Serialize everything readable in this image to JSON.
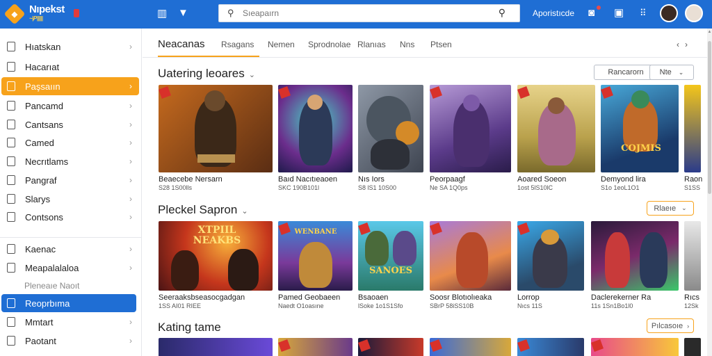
{
  "app": {
    "logo_text": "Nıpekst",
    "logo_sub": "~|P|||||"
  },
  "header": {
    "search_placeholder": "Sıeapaırn",
    "admin_label": "Aporistıcde"
  },
  "sidebar": {
    "items": [
      {
        "label": "Hıatskan"
      },
      {
        "label": "Hacarıat"
      },
      {
        "label": "Paşsaıın"
      },
      {
        "label": "Pancamd"
      },
      {
        "label": "Cantsans"
      },
      {
        "label": "Camed"
      },
      {
        "label": "Necrıtlams"
      },
      {
        "label": "Pangraf"
      },
      {
        "label": "Slarys"
      },
      {
        "label": "Contsons"
      }
    ],
    "items2": [
      {
        "label": "Kaenac"
      },
      {
        "label": "Meapalalaloa"
      },
      {
        "label": "Reoprbıma"
      },
      {
        "label": "Mmtart"
      },
      {
        "label": "Paotant"
      }
    ],
    "muted_label": "Pleneaıe Naoıt"
  },
  "tabs": {
    "items": [
      "Neacanas",
      "Rsagans",
      "Nemen",
      "Sprodnolae",
      "Rlanıas",
      "Nns",
      "Ptsen"
    ]
  },
  "sections": [
    {
      "title": "Uatering leoares",
      "buttons": [
        "Rancarorn",
        "Nte"
      ],
      "cards": [
        {
          "title": "Beaecebe Nersarn",
          "sub": "S28 1S00lls"
        },
        {
          "title": "Baıd Nacıtıeaoen",
          "sub": "SKC 190B101l"
        },
        {
          "title": "Nıs Iors",
          "sub": "S8 lS1 10S00"
        },
        {
          "title": "Peorpaagf",
          "sub": "Ne SA 1Q0ps"
        },
        {
          "title": "Aoared Soeon",
          "sub": "1ost 5lS10lC"
        },
        {
          "title": "Demyond lira",
          "sub": "S1o 1eoL1O1"
        },
        {
          "title": "Raon",
          "sub": "S1SS"
        }
      ]
    },
    {
      "title": "Pleckel Sapron",
      "button": "Rlaeıe",
      "cards": [
        {
          "title": "Seeraaksbseasocgadgan",
          "sub": "1SS AI01 RIEE"
        },
        {
          "title": "Pamed Geobaeen",
          "sub": "Naedt O1oasıne"
        },
        {
          "title": "Bsaoaen",
          "sub": "lSoke 1o1S1Sfo"
        },
        {
          "title": "Soosr Blotıolıeaka",
          "sub": "SBrP 58iSS10B"
        },
        {
          "title": "Lorrop",
          "sub": "Nıcs 11S"
        },
        {
          "title": "Daclerekerner Ra",
          "sub": "11s 1Sn1Bo1l0"
        },
        {
          "title": "Rıcs",
          "sub": "12Sk"
        }
      ],
      "thumb_banners": [
        "XTPIIL NEAKBS",
        "WENBANE",
        "SANOES"
      ]
    },
    {
      "title": "Kating tame",
      "button": "Pılcasoıe"
    }
  ],
  "colors": {
    "topbar": "#1f6ed4",
    "accent_orange": "#f7a21b",
    "active_blue": "#1f6ed4"
  },
  "icons": {
    "grid": "grid-icon",
    "dropdown": "chevron-down-icon",
    "search": "search-icon",
    "camera": "camera-icon",
    "bag": "bag-icon",
    "apps": "apps-icon"
  }
}
